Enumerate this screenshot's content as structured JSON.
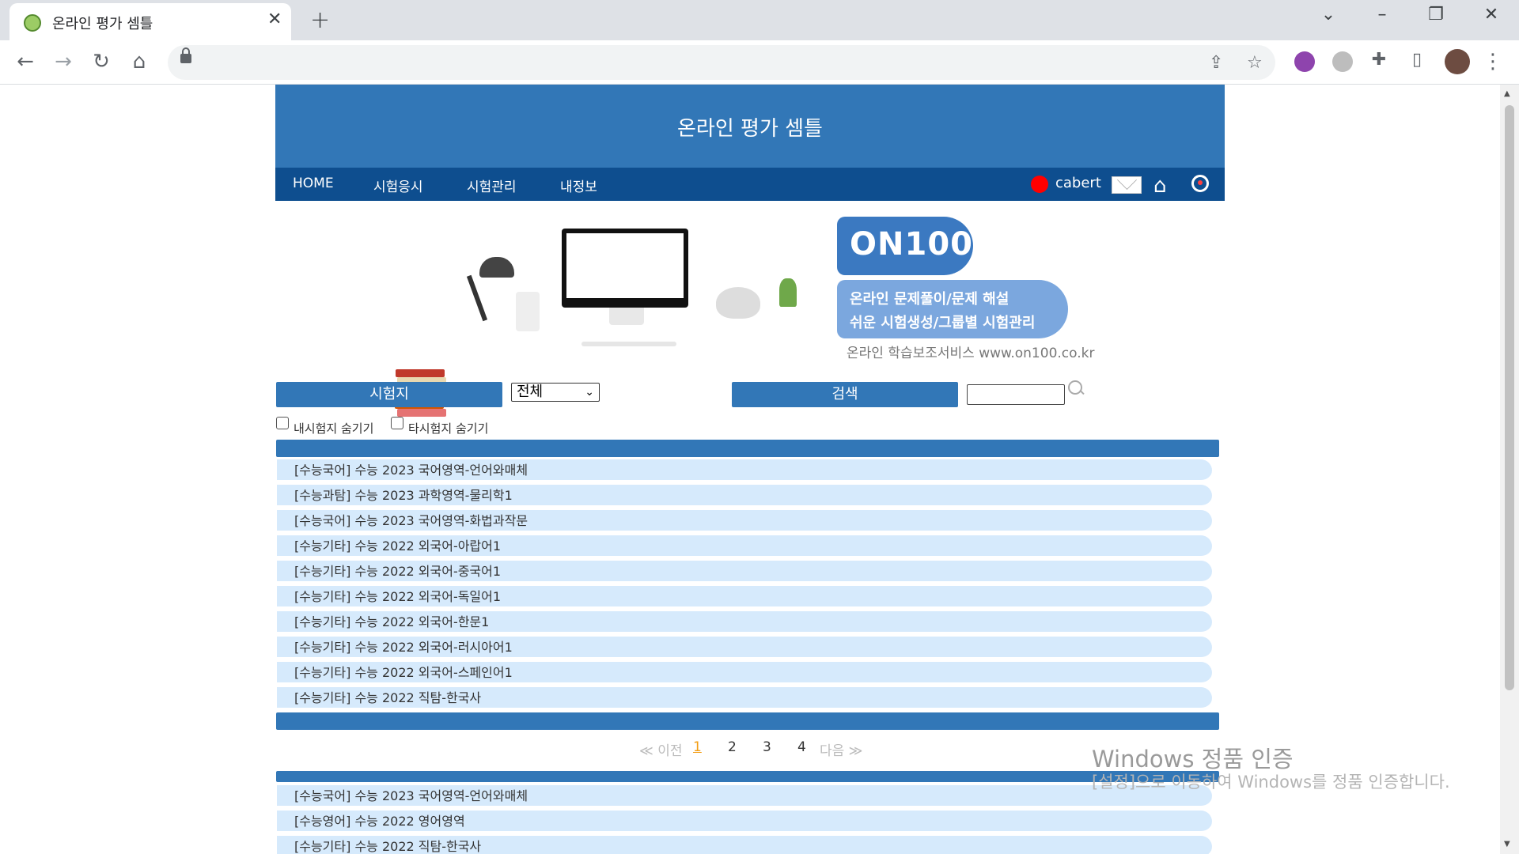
{
  "browser": {
    "tab_title": "온라인 평가 셈틀",
    "new_tab": "+",
    "close_tab": "✕"
  },
  "site": {
    "title": "온라인 평가 셈틀",
    "nav": [
      "HOME",
      "시험응시",
      "시험관리",
      "내정보"
    ],
    "username": "cabert",
    "status_color": "#ff0000",
    "accent": "#3277b7",
    "nav_bg": "#0e4e8f"
  },
  "banner": {
    "logo": "ON100",
    "slogan_1": "온라인 문제풀이/문제 해설",
    "slogan_2": "쉬운 시험생성/그룹별 시험관리",
    "caption": "온라인 학습보조서비스 www.on100.co.kr"
  },
  "filters": {
    "exam_label": "시험지",
    "exam_select": "전체",
    "search_label": "검색",
    "search_value": "",
    "hide_mine": "내시험지 숨기기",
    "hide_others": "타시험지 숨기기"
  },
  "list1": [
    "[수능국어] 수능 2023 국어영역-언어와매체",
    "[수능과탐] 수능 2023 과학영역-물리학1",
    "[수능국어] 수능 2023 국어영역-화법과작문",
    "[수능기타] 수능 2022 외국어-아랍어1",
    "[수능기타] 수능 2022 외국어-중국어1",
    "[수능기타] 수능 2022 외국어-독일어1",
    "[수능기타] 수능 2022 외국어-한문1",
    "[수능기타] 수능 2022 외국어-러시아어1",
    "[수능기타] 수능 2022 외국어-스페인어1",
    "[수능기타] 수능 2022 직탐-한국사"
  ],
  "pagination": {
    "prev": "≪ 이전",
    "pages": [
      "1",
      "2",
      "3",
      "4"
    ],
    "current": "1",
    "next": "다음 ≫"
  },
  "list2": [
    "[수능국어] 수능 2023 국어영역-언어와매체",
    "[수능영어] 수능 2022 영어영역",
    "[수능기타] 수능 2022 직탐-한국사"
  ],
  "watermark": {
    "title": "Windows 정품 인증",
    "text": "[설정]으로 이동하여 Windows를 정품 인증합니다."
  }
}
